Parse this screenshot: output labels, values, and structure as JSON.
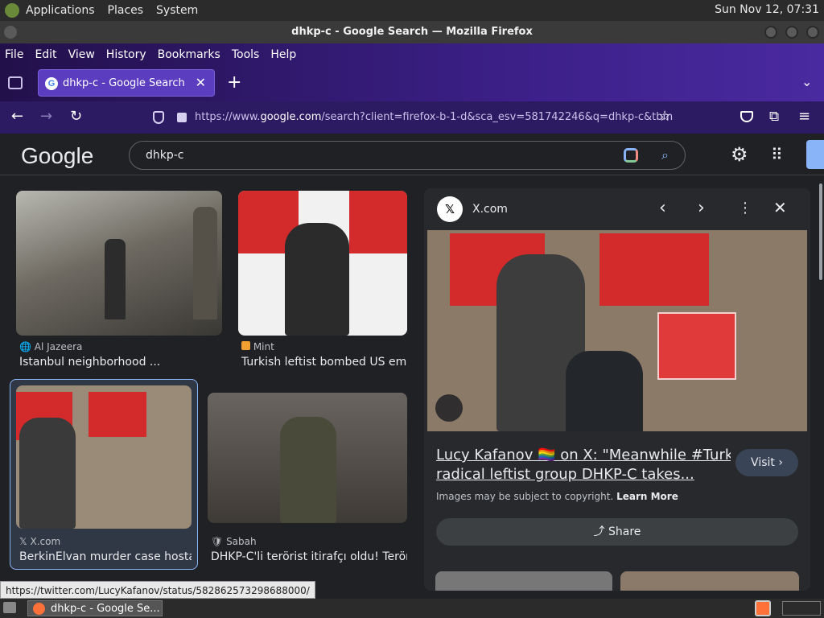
{
  "top_panel": {
    "menus": [
      "Applications",
      "Places",
      "System"
    ],
    "clock": "Sun Nov 12, 07:31"
  },
  "window": {
    "title": "dhkp-c - Google Search — Mozilla Firefox"
  },
  "firefox": {
    "menubar": [
      "File",
      "Edit",
      "View",
      "History",
      "Bookmarks",
      "Tools",
      "Help"
    ],
    "tab_title": "dhkp-c - Google Search",
    "url_prefix": "https://www.",
    "url_domain": "google.com",
    "url_rest": "/search?client=firefox-b-1-d&sca_esv=581742246&q=dhkp-c&tbm"
  },
  "google": {
    "logo": "Google",
    "query": "dhkp-c"
  },
  "results": [
    {
      "source": "Al Jazeera",
      "caption": "Istanbul neighborhood ..."
    },
    {
      "source": "Mint",
      "caption": "Turkish leftist bombed US em..."
    },
    {
      "source": "X.com",
      "caption": "BerkinElvan murder case hosta..."
    },
    {
      "source": "Sabah",
      "caption": "DHKP-C'li terörist itirafçı oldu! Terör..."
    }
  ],
  "preview": {
    "source": "X.com",
    "title_line1": "Lucy Kafanov 🏳️‍🌈 on X: \"Meanwhile #Turkish",
    "title_line2": "radical leftist group DHKP-C takes...",
    "visit_label": "Visit",
    "copyright": "Images may be subject to copyright.",
    "learn_more": "Learn More",
    "share_label": "Share"
  },
  "status_url": "https://twitter.com/LucyKafanov/status/582862573298688000/",
  "taskbar": {
    "item_label": "dhkp-c - Google Se..."
  },
  "colors": {
    "accent": "#8ab4f8",
    "ff_purple": "#3b1f86"
  }
}
